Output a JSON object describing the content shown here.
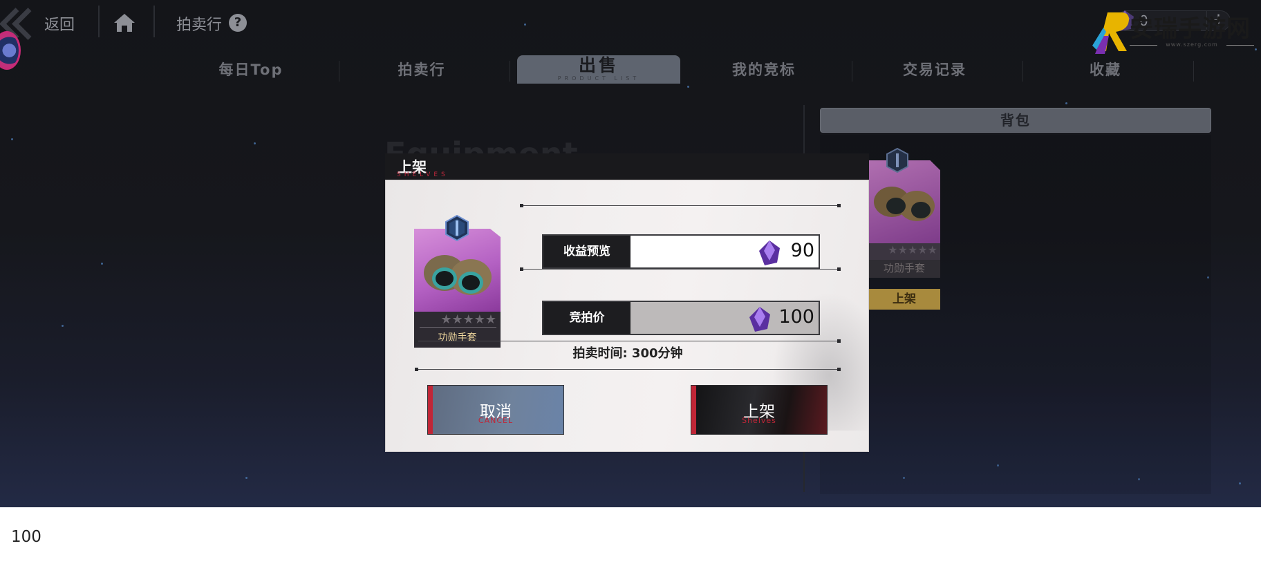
{
  "topbar": {
    "back_label": "返回",
    "section_label": "拍卖行",
    "currency_value": "0",
    "icons": [
      "back-chevron-icon",
      "home-icon",
      "help-icon",
      "gem-icon",
      "plus-icon"
    ]
  },
  "tabs": [
    {
      "label": "每日Top",
      "active": false
    },
    {
      "label": "拍卖行",
      "active": false
    },
    {
      "label": "出售",
      "sub": "PRODUCT LIST",
      "active": true
    },
    {
      "label": "我的竞标",
      "active": false
    },
    {
      "label": "交易记录",
      "active": false
    },
    {
      "label": "收藏",
      "active": false
    }
  ],
  "background_heading": "Equipment",
  "bag": {
    "title": "背包",
    "item": {
      "name": "功勋手套",
      "stars": "★★★★★",
      "action_label": "上架"
    }
  },
  "modal": {
    "title": "上架",
    "subtitle": "SHELVES",
    "item": {
      "name": "功勋手套",
      "stars": "★★★★★"
    },
    "revenue": {
      "label": "收益预览",
      "value": "90"
    },
    "bid": {
      "label": "竞拍价",
      "value": "100"
    },
    "auction_time": "拍卖时间: 300分钟",
    "cancel_button": {
      "label": "取消",
      "sub": "CANCEL"
    },
    "shelf_button": {
      "label": "上架",
      "sub": "Shelves"
    }
  },
  "footer": {
    "number": "100",
    "logo_text": "安瑞手游网",
    "logo_url": "www.szerg.com"
  },
  "colors": {
    "accent_red": "#c02637",
    "gem_purple": "#7b48c7",
    "card_purple": "#b461c3",
    "gold": "#a88a3d"
  }
}
